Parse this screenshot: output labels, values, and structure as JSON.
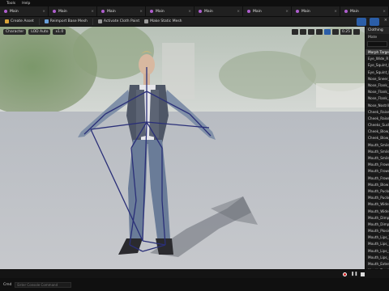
{
  "menu": [
    "Tools",
    "Help"
  ],
  "tabs": [
    {
      "label": "Main"
    },
    {
      "label": "Main"
    },
    {
      "label": "Main"
    },
    {
      "label": "Main"
    },
    {
      "label": "Main"
    },
    {
      "label": "Main"
    },
    {
      "label": "Main"
    },
    {
      "label": "Main"
    }
  ],
  "toolbar": {
    "create_asset": "Create Asset",
    "reimport": "Reimport Base Mesh",
    "activate_cloth": "Activate Cloth Paint",
    "make_static": "Make Static Mesh"
  },
  "viewport": {
    "chip1": "Character",
    "chip2": "LOD Auto",
    "chip3": "x1.0",
    "zoom": "0.25"
  },
  "panel": {
    "title": "Clothing",
    "sub": "Mate",
    "items": [
      "Morph Targets",
      "Eye_Wide_R",
      "Eye_Squint_L",
      "Eye_Squint_R",
      "Nose_Sneer_L",
      "Nose_Flank_L",
      "Nose_Flank_R",
      "Nose_Flank_Up",
      "Nose_Nostril_L",
      "Cheek_Raise_L",
      "Cheek_Raise_R",
      "Cheeks_Suck",
      "Cheek_Blow_L",
      "Cheek_Blow_R",
      "Mouth_Smile_L",
      "Mouth_Smile_R",
      "Mouth_Smile_Wide",
      "Mouth_Frown_L",
      "Mouth_Frown_R",
      "Mouth_Frown_Wide",
      "Mouth_Blow",
      "Mouth_Pucker",
      "Mouth_Pucker_Wide",
      "Mouth_Widen",
      "Mouth_Widen_Lower",
      "Mouth_Dimple_L",
      "Mouth_Dimple_R",
      "Mouth_Plosive",
      "Mouth_Lips_Tight",
      "Mouth_Lips_Part",
      "Mouth_Lips_Open",
      "Mouth_Lips_Close",
      "Mouth_Extend",
      "Mouth_Top_Lip"
    ]
  },
  "bottom": {
    "cmd_label": "Cmd",
    "cmd_placeholder": "Enter Console Command"
  }
}
